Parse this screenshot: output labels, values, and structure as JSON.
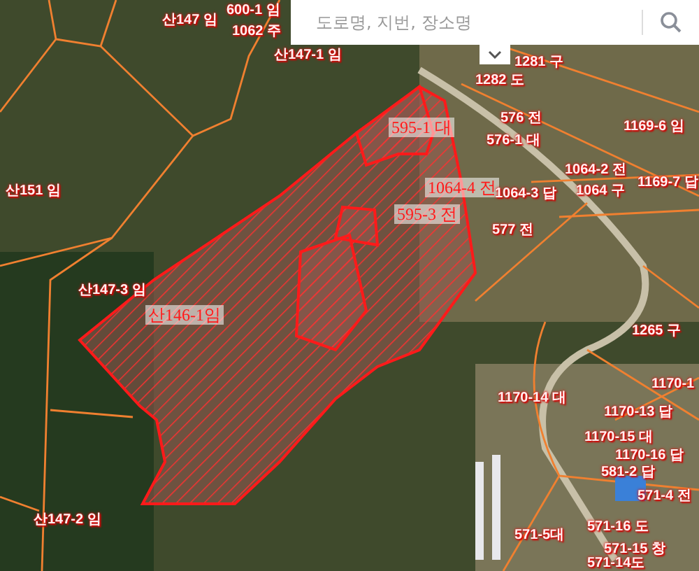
{
  "search": {
    "placeholder": "도로명, 지번, 장소명"
  },
  "parcel_labels": [
    {
      "text": "산147 임",
      "kind": "minor"
    },
    {
      "text": "600-1 임",
      "kind": "minor"
    },
    {
      "text": "1062 주",
      "kind": "minor"
    },
    {
      "text": "산147-1 임",
      "kind": "minor"
    },
    {
      "text": "산151 임",
      "kind": "minor"
    },
    {
      "text": "1281 구",
      "kind": "minor"
    },
    {
      "text": "1282 도",
      "kind": "minor"
    },
    {
      "text": "1169-6 임",
      "kind": "minor"
    },
    {
      "text": "576 전",
      "kind": "minor"
    },
    {
      "text": "576-1 대",
      "kind": "minor"
    },
    {
      "text": "595-1 대",
      "kind": "major"
    },
    {
      "text": "1064-4 전",
      "kind": "major"
    },
    {
      "text": "1064-3 답",
      "kind": "minor"
    },
    {
      "text": "1064-2 전",
      "kind": "minor"
    },
    {
      "text": "1064 구",
      "kind": "minor"
    },
    {
      "text": "1169-7 답",
      "kind": "minor"
    },
    {
      "text": "595-3 전",
      "kind": "major"
    },
    {
      "text": "577 전",
      "kind": "minor"
    },
    {
      "text": "산147-3 임",
      "kind": "minor"
    },
    {
      "text": "산146-1임",
      "kind": "major"
    },
    {
      "text": "1265 구",
      "kind": "minor"
    },
    {
      "text": "1170-1",
      "kind": "minor"
    },
    {
      "text": "1170-14 대",
      "kind": "minor"
    },
    {
      "text": "1170-13 답",
      "kind": "minor"
    },
    {
      "text": "1170-15 대",
      "kind": "minor"
    },
    {
      "text": "1170-16 답",
      "kind": "minor"
    },
    {
      "text": "581-2 답",
      "kind": "minor"
    },
    {
      "text": "571-4 전",
      "kind": "minor"
    },
    {
      "text": "571-5대",
      "kind": "minor"
    },
    {
      "text": "571-16 도",
      "kind": "minor"
    },
    {
      "text": "571-15 창",
      "kind": "minor"
    },
    {
      "text": "571-14도",
      "kind": "minor"
    },
    {
      "text": "산147-2 임",
      "kind": "minor"
    }
  ]
}
